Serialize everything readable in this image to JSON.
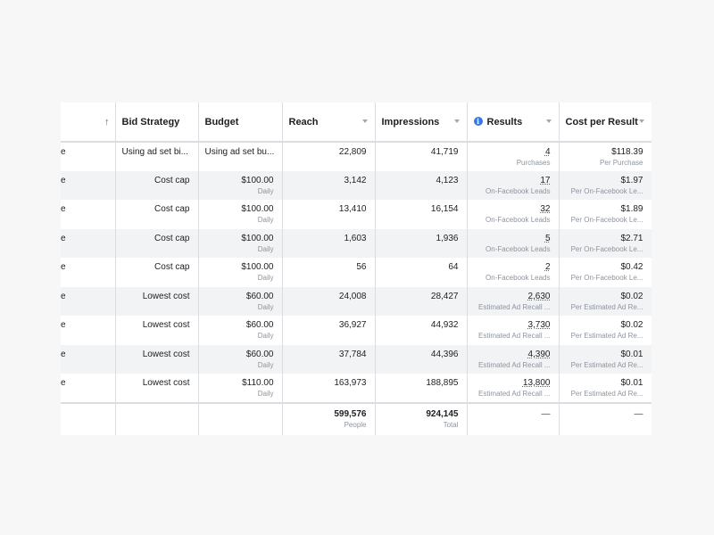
{
  "columns": {
    "sort_indicator": "↑",
    "bid_strategy": "Bid Strategy",
    "budget": "Budget",
    "reach": "Reach",
    "impressions": "Impressions",
    "results": "Results",
    "cost_per_result": "Cost per Result"
  },
  "rows": [
    {
      "name": "e",
      "bid": "Using ad set bi...",
      "budget": "Using ad set bu...",
      "budget_period": "",
      "reach": "22,809",
      "impressions": "41,719",
      "results": "4",
      "results_type": "Purchases",
      "cost": "$118.39",
      "cost_type": "Per Purchase"
    },
    {
      "name": "e",
      "bid": "Cost cap",
      "budget": "$100.00",
      "budget_period": "Daily",
      "reach": "3,142",
      "impressions": "4,123",
      "results": "17",
      "results_type": "On-Facebook Leads",
      "cost": "$1.97",
      "cost_type": "Per On-Facebook Le..."
    },
    {
      "name": "e",
      "bid": "Cost cap",
      "budget": "$100.00",
      "budget_period": "Daily",
      "reach": "13,410",
      "impressions": "16,154",
      "results": "32",
      "results_type": "On-Facebook Leads",
      "cost": "$1.89",
      "cost_type": "Per On-Facebook Le..."
    },
    {
      "name": "e",
      "bid": "Cost cap",
      "budget": "$100.00",
      "budget_period": "Daily",
      "reach": "1,603",
      "impressions": "1,936",
      "results": "5",
      "results_type": "On-Facebook Leads",
      "cost": "$2.71",
      "cost_type": "Per On-Facebook Le..."
    },
    {
      "name": "e",
      "bid": "Cost cap",
      "budget": "$100.00",
      "budget_period": "Daily",
      "reach": "56",
      "impressions": "64",
      "results": "2",
      "results_type": "On-Facebook Leads",
      "cost": "$0.42",
      "cost_type": "Per On-Facebook Le..."
    },
    {
      "name": "e",
      "bid": "Lowest cost",
      "budget": "$60.00",
      "budget_period": "Daily",
      "reach": "24,008",
      "impressions": "28,427",
      "results": "2,630",
      "results_type": "Estimated Ad Recall ...",
      "cost": "$0.02",
      "cost_type": "Per Estimated Ad Re..."
    },
    {
      "name": "e",
      "bid": "Lowest cost",
      "budget": "$60.00",
      "budget_period": "Daily",
      "reach": "36,927",
      "impressions": "44,932",
      "results": "3,730",
      "results_type": "Estimated Ad Recall ...",
      "cost": "$0.02",
      "cost_type": "Per Estimated Ad Re..."
    },
    {
      "name": "e",
      "bid": "Lowest cost",
      "budget": "$60.00",
      "budget_period": "Daily",
      "reach": "37,784",
      "impressions": "44,396",
      "results": "4,390",
      "results_type": "Estimated Ad Recall ...",
      "cost": "$0.01",
      "cost_type": "Per Estimated Ad Re..."
    },
    {
      "name": "e",
      "bid": "Lowest cost",
      "budget": "$110.00",
      "budget_period": "Daily",
      "reach": "163,973",
      "impressions": "188,895",
      "results": "13,800",
      "results_type": "Estimated Ad Recall ...",
      "cost": "$0.01",
      "cost_type": "Per Estimated Ad Re..."
    }
  ],
  "totals": {
    "reach": "599,576",
    "reach_label": "People",
    "impressions": "924,145",
    "impressions_label": "Total",
    "results": "—",
    "cost": "—"
  },
  "colors": {
    "accent": "#1877f2",
    "border": "#dadde1",
    "alt_row": "#f2f3f5"
  },
  "icons": {
    "results_info": "info-icon",
    "sort": "sort-arrow-up-icon",
    "column_menu": "caret-down-icon"
  }
}
